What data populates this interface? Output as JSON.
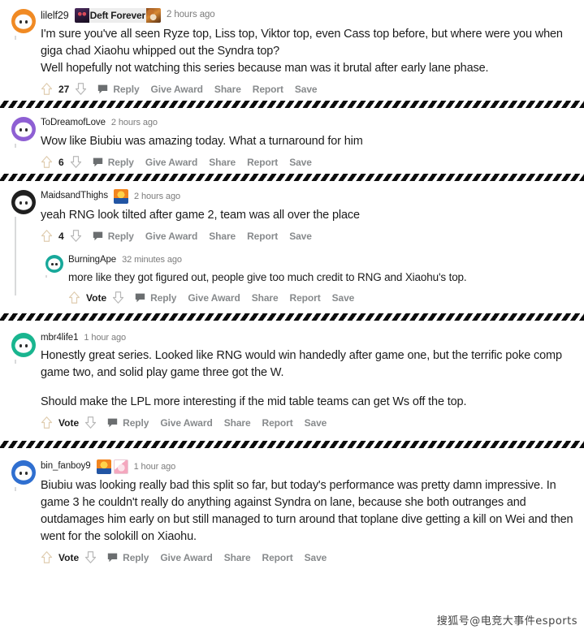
{
  "page": {
    "watermark": "搜狐号@电竞大事件esports"
  },
  "labels": {
    "reply": "Reply",
    "give_award": "Give Award",
    "share": "Share",
    "report": "Report",
    "save": "Save",
    "vote": "Vote",
    "upvote_icon": "upvote-arrow-icon",
    "downvote_icon": "downvote-arrow-icon",
    "comment_icon": "speech-bubble-icon"
  },
  "colors": {
    "text": "#1c1c1c",
    "muted": "#878a8c",
    "timestamp": "#7c7c7c",
    "threadline": "#d9dadb",
    "upvote_outline": "#e0cdb0",
    "downvote_outline": "#b8b8b8",
    "flair_bg": "#ededed"
  },
  "comments": [
    {
      "id": "c1",
      "username": "lilelf29",
      "timestamp": "2 hours ago",
      "avatar_color": "#f08a24",
      "score": "27",
      "depth": 0,
      "flair": {
        "text": "Deft Forever",
        "left_icon": "syndra-champion-icon",
        "right_icon": "gnar-champion-icon"
      },
      "paragraphs": [
        "I'm sure you've all seen Ryze top, Liss top, Viktor top, even Cass top before, but where were you when giga chad Xiaohu whipped out the Syndra top?\nWell hopefully not watching this series because man was it brutal after early lane phase."
      ]
    },
    {
      "id": "c2",
      "username": "ToDreamofLove",
      "timestamp": "2 hours ago",
      "avatar_color": "#8e5fd3",
      "score": "6",
      "depth": 0,
      "flair": null,
      "paragraphs": [
        "Wow like Biubiu was amazing today. What a turnaround for him"
      ]
    },
    {
      "id": "c3",
      "username": "MaidsandThighs",
      "timestamp": "2 hours ago",
      "avatar_color": "#1f1f1f",
      "score": "4",
      "depth": 0,
      "flair": {
        "text": "",
        "left_icon": "suning-team-icon",
        "right_icon": ""
      },
      "paragraphs": [
        "yeah RNG look tilted after game 2, team was all over the place"
      ]
    },
    {
      "id": "c4",
      "username": "BurningApe",
      "timestamp": "32 minutes ago",
      "avatar_color": "#17a89a",
      "score": "Vote",
      "depth": 1,
      "flair": null,
      "paragraphs": [
        "more like they got figured out, people give too much credit to RNG and Xiaohu's top."
      ]
    },
    {
      "id": "c5",
      "username": "mbr4life1",
      "timestamp": "1 hour ago",
      "avatar_color": "#19b58f",
      "score": "Vote",
      "depth": 0,
      "flair": null,
      "paragraphs": [
        "Honestly great series. Looked like RNG would win handedly after game one, but the terrific poke comp game two, and solid play game three got the W.",
        "Should make the LPL more interesting if the mid table teams can get Ws off the top."
      ]
    },
    {
      "id": "c6",
      "username": "bin_fanboy9",
      "timestamp": "1 hour ago",
      "avatar_color": "#2f6fd0",
      "score": "Vote",
      "depth": 0,
      "flair": {
        "text": "",
        "left_icon": "suning-team-icon",
        "right_icon": "pink-team-icon"
      },
      "paragraphs": [
        "Biubiu was looking really bad this split so far, but today's performance was pretty damn impressive. In game 3 he couldn't really do anything against Syndra on lane, because she both outranges and outdamages him early on but still managed to turn around that toplane dive getting a kill on Wei and then went for the solokill on Xiaohu."
      ]
    }
  ]
}
